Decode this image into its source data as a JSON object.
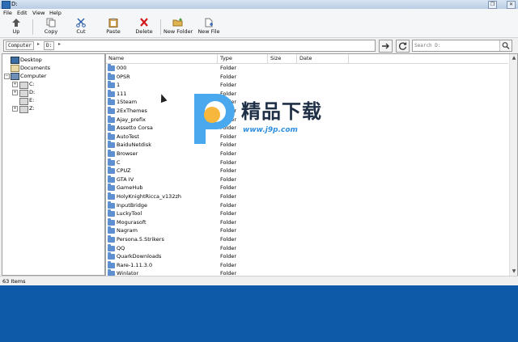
{
  "window": {
    "title": "D:"
  },
  "menu": [
    "File",
    "Edit",
    "View",
    "Help"
  ],
  "toolbar": {
    "up": "Up",
    "copy": "Copy",
    "cut": "Cut",
    "paste": "Paste",
    "delete": "Delete",
    "new_folder": "New Folder",
    "new_file": "New File"
  },
  "address": {
    "crumbs": [
      "Computer",
      "D:"
    ],
    "search_placeholder": "Search D:"
  },
  "tree": {
    "desktop": "Desktop",
    "documents": "Documents",
    "computer": "Computer",
    "drives": [
      "C:",
      "D:",
      "E:",
      "Z:"
    ]
  },
  "list": {
    "columns": [
      "Name",
      "Type",
      "Size",
      "Date"
    ],
    "rows": [
      {
        "name": "000",
        "type": "Folder"
      },
      {
        "name": "0PSR",
        "type": "Folder"
      },
      {
        "name": "1",
        "type": "Folder"
      },
      {
        "name": "111",
        "type": "Folder"
      },
      {
        "name": "1Steam",
        "type": "Folder"
      },
      {
        "name": "2ExThemes",
        "type": "Folder"
      },
      {
        "name": "Ajay_prefix",
        "type": "Folder"
      },
      {
        "name": "Assetto Corsa",
        "type": "Folder"
      },
      {
        "name": "AutoTest",
        "type": "Folder"
      },
      {
        "name": "BaiduNetdisk",
        "type": "Folder"
      },
      {
        "name": "Browser",
        "type": "Folder"
      },
      {
        "name": "C",
        "type": "Folder"
      },
      {
        "name": "CPUZ",
        "type": "Folder"
      },
      {
        "name": "GTA IV",
        "type": "Folder"
      },
      {
        "name": "GameHub",
        "type": "Folder"
      },
      {
        "name": "HolyKnightRicca_v132zh",
        "type": "Folder"
      },
      {
        "name": "InputBridge",
        "type": "Folder"
      },
      {
        "name": "LuckyTool",
        "type": "Folder"
      },
      {
        "name": "Mogurasoft",
        "type": "Folder"
      },
      {
        "name": "Nagram",
        "type": "Folder"
      },
      {
        "name": "Persona.5.Strikers",
        "type": "Folder"
      },
      {
        "name": "QQ",
        "type": "Folder"
      },
      {
        "name": "QuarkDownloads",
        "type": "Folder"
      },
      {
        "name": "Rare-1.11.3.0",
        "type": "Folder"
      },
      {
        "name": "Winlator",
        "type": "Folder"
      }
    ]
  },
  "status": {
    "items": "63 Items"
  },
  "watermark": {
    "title": "精品下载",
    "url": "www.j9p.com"
  }
}
